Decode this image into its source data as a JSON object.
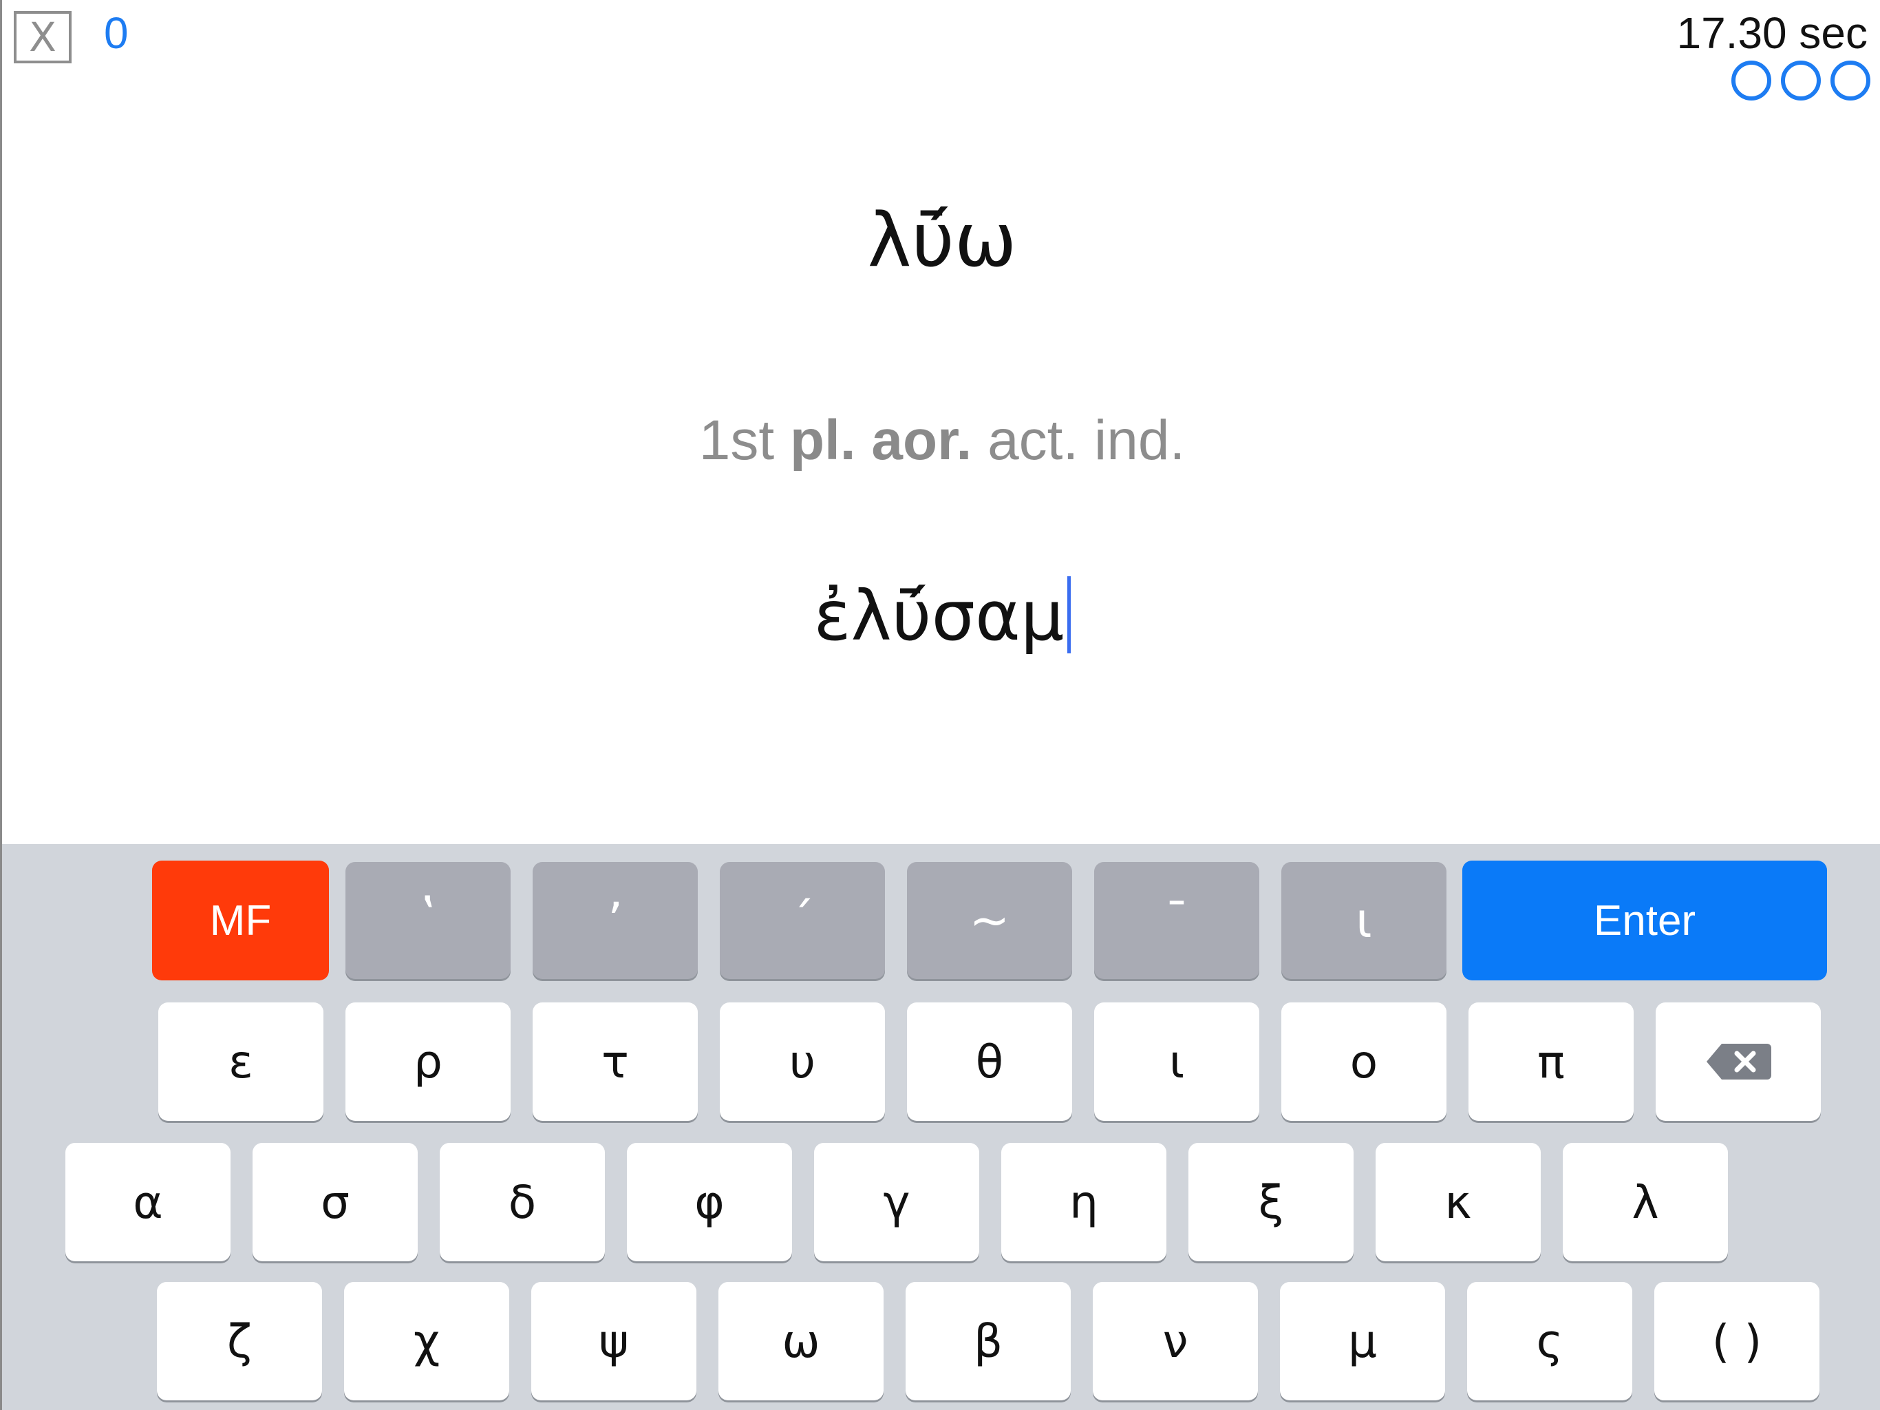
{
  "top_bar": {
    "close_label": "X",
    "score": "0",
    "timer": "17.30 sec",
    "lives": [
      "life",
      "life",
      "life"
    ],
    "accent_color": "#1d7cf2"
  },
  "question": {
    "lemma": "λῡ́ω",
    "parsing_person": "1st",
    "parsing_number": "pl.",
    "parsing_tense": "aor.",
    "parsing_voice": "act.",
    "parsing_mood": "ind."
  },
  "answer": {
    "value": "ἐλῡ́σαμ"
  },
  "keyboard": {
    "mf_label": "MF",
    "enter_label": "Enter",
    "diacritics": [
      {
        "label": "ʽ",
        "name": "rough-breathing-key"
      },
      {
        "label": "ʼ",
        "name": "smooth-breathing-key"
      },
      {
        "label": "´",
        "name": "acute-accent-key"
      },
      {
        "label": "~",
        "name": "circumflex-key"
      },
      {
        "label": "¯",
        "name": "macron-key"
      },
      {
        "label": "ι",
        "name": "iota-subscript-key"
      }
    ],
    "row1": [
      "ε",
      "ρ",
      "τ",
      "υ",
      "θ",
      "ι",
      "ο",
      "π"
    ],
    "row2": [
      "α",
      "σ",
      "δ",
      "φ",
      "γ",
      "η",
      "ξ",
      "κ",
      "λ"
    ],
    "row3": [
      "ζ",
      "χ",
      "ψ",
      "ω",
      "β",
      "ν",
      "μ",
      "ς",
      "( )"
    ],
    "colors": {
      "mf": "#ff3a0a",
      "enter": "#0a7af8",
      "modifier": "#a9abb4",
      "keyboard_bg": "#d1d5db"
    }
  }
}
